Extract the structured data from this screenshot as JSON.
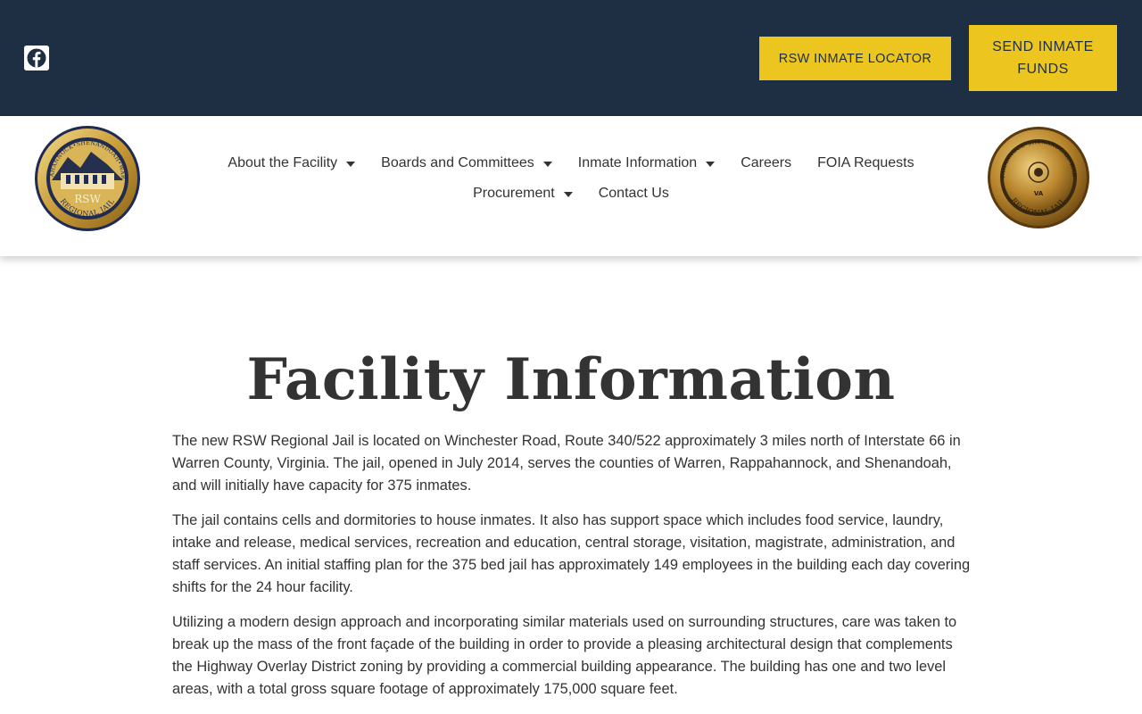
{
  "topbar": {
    "social_icon": "facebook-icon",
    "locator_label": "RSW INMATE LOCATOR",
    "funds_label": "SEND INMATE FUNDS"
  },
  "header": {
    "logo_left": {
      "ring_text_top": "RAPPAHANNOCK•SHENANDOAH•WARREN",
      "center_text": "RSW",
      "ring_text_bottom": "REGIONAL JAIL"
    },
    "logo_right": {
      "ring_text_top": "RAPPAHANNOCK•SHENANDOAH•WARREN",
      "ring_text_bottom": "REGIONAL JAIL",
      "center_text": "VA"
    },
    "nav": [
      {
        "label": "About the Facility",
        "dropdown": true
      },
      {
        "label": "Boards and Committees",
        "dropdown": true
      },
      {
        "label": "Inmate Information",
        "dropdown": true
      },
      {
        "label": "Careers",
        "dropdown": false
      },
      {
        "label": "FOIA Requests",
        "dropdown": false
      },
      {
        "label": "Procurement",
        "dropdown": true
      },
      {
        "label": "Contact Us",
        "dropdown": false
      }
    ]
  },
  "main": {
    "title": "Facility Information",
    "paragraphs": [
      "The new RSW Regional Jail is located on Winchester Road, Route 340/522 approximately 3 miles north of Interstate 66 in Warren County, Virginia. The jail, opened in July 2014, serves the counties of Warren, Rappahannock, and Shenandoah, and will initially have capacity for 375 inmates.",
      "The jail contains cells and dormitories to house inmates. It also has support space which includes food service, laundry, intake and release, medical services, recreation and education, central storage, visitation, magistrate, administration, and staff services. An initial staffing plan for the 375 bed jail has approximately 149 employees in the building each day covering shifts for the 24 hour facility.",
      "Utilizing a modern design approach and incorporating similar materials used on surrounding structures, care was taken to break up the mass of the front façade of the building in order to provide a pleasing architectural design that complements the Highway Overlay District zoning by providing a commercial building appearance. The building has one and two level areas, with a total gross square footage of approximately 175,000 square feet."
    ]
  },
  "colors": {
    "topbar_bg": "#1e2f44",
    "button_bg": "#ecc61e",
    "text": "#333333"
  }
}
